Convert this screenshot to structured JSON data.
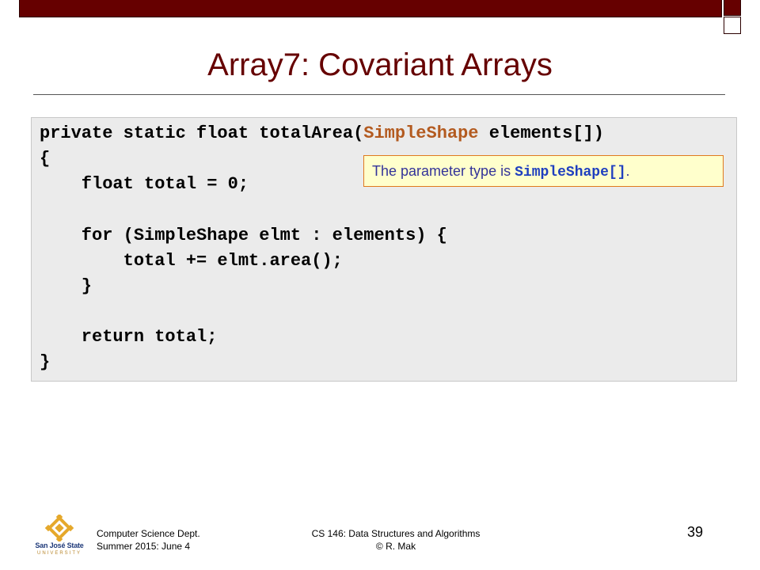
{
  "slide": {
    "title": "Array7: Covariant Arrays"
  },
  "code": {
    "line1_pre": "private static float totalArea(",
    "line1_type": "SimpleShape",
    "line1_post": " elements[])",
    "line2": "{",
    "line3": "    float total = 0;",
    "line4": "    for (SimpleShape elmt : elements) {",
    "line5": "        total += elmt.area();",
    "line6": "    }",
    "line7": "    return total;",
    "line8": "}"
  },
  "callout": {
    "text_pre": "The parameter type is ",
    "code": "SimpleShape[]",
    "text_post": "."
  },
  "footer": {
    "dept": "Computer Science Dept.",
    "term": "Summer 2015: June 4",
    "course": "CS 146: Data Structures and Algorithms",
    "author": "© R. Mak",
    "page_number": "39"
  },
  "logo": {
    "line1": "San José State",
    "line2": "UNIVERSITY",
    "colors": {
      "gold": "#e5a82b",
      "blue": "#1f3a7a"
    }
  },
  "colors": {
    "accent": "#660000",
    "code_type": "#b35a1f",
    "callout_text": "#333399",
    "callout_border": "#e07a1f",
    "callout_bg": "#ffffcc"
  }
}
